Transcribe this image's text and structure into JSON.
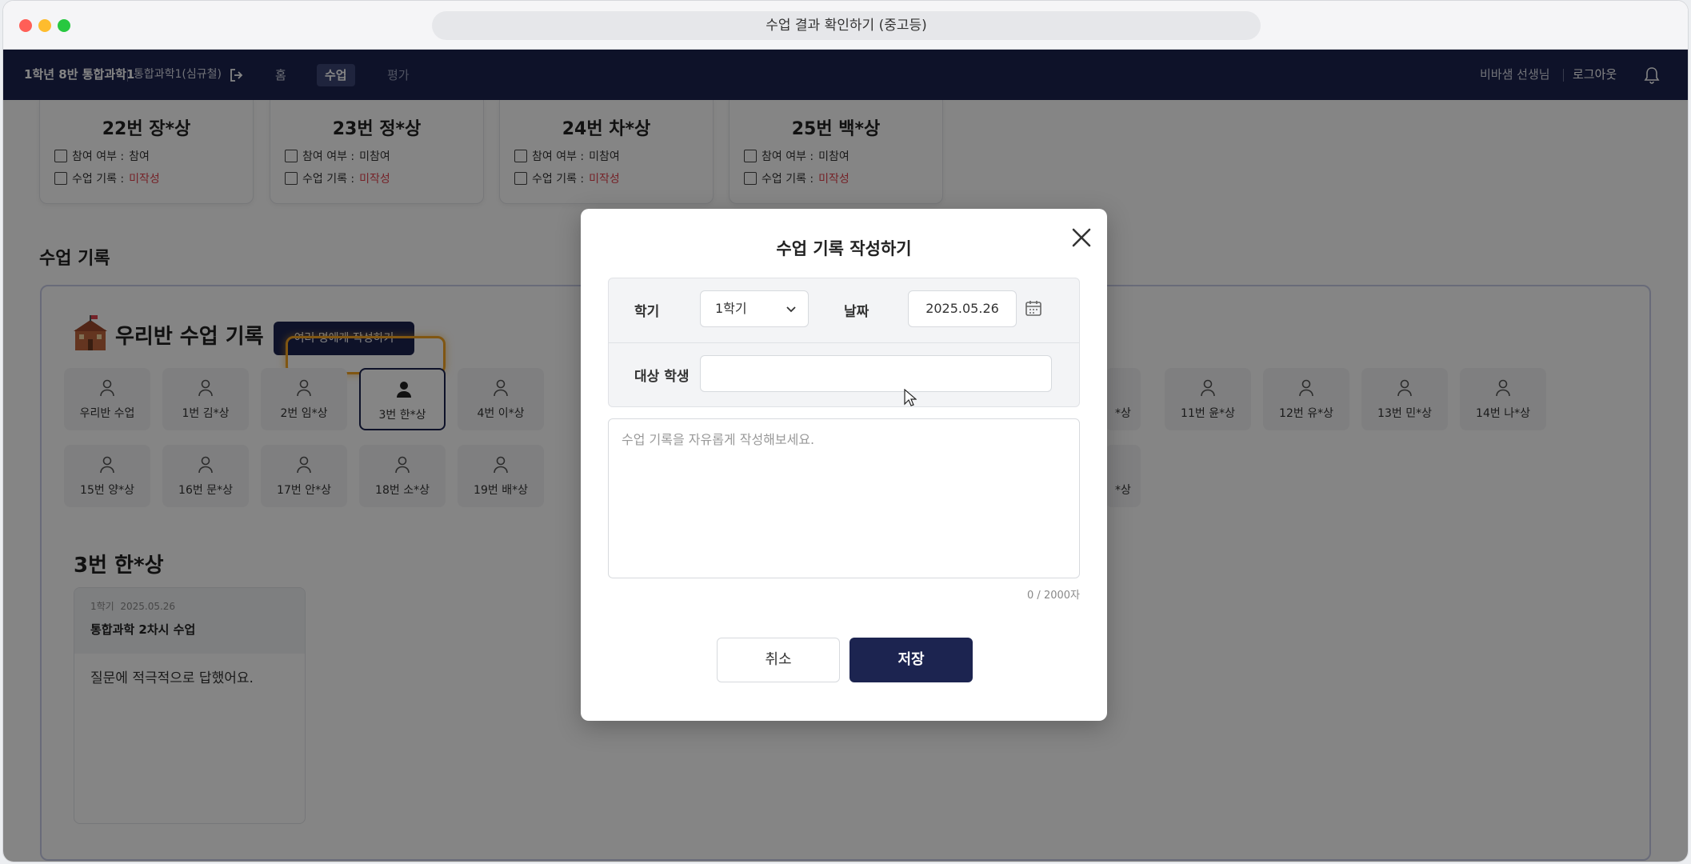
{
  "browser": {
    "tab_title": "수업 결과 확인하기 (중고등)"
  },
  "nav": {
    "class_name": "1학년 8반 통합과학1",
    "subject": "통합과학1(심규철)",
    "home": "홈",
    "class": "수업",
    "evaluation": "평가",
    "teacher": "비바샘 선생님",
    "logout": "로그아웃"
  },
  "top_cards": [
    {
      "name": "22번 장*상",
      "participation_label": "참여 여부 : ",
      "participation_value": "참여",
      "record_label": "수업 기록 : ",
      "record_value": "미작성"
    },
    {
      "name": "23번 정*상",
      "participation_label": "참여 여부 : ",
      "participation_value": "미참여",
      "record_label": "수업 기록 : ",
      "record_value": "미작성"
    },
    {
      "name": "24번 차*상",
      "participation_label": "참여 여부 : ",
      "participation_value": "미참여",
      "record_label": "수업 기록 : ",
      "record_value": "미작성"
    },
    {
      "name": "25번 백*상",
      "participation_label": "참여 여부 : ",
      "participation_value": "미참여",
      "record_label": "수업 기록 : ",
      "record_value": "미작성"
    }
  ],
  "section_title": "수업 기록",
  "panel": {
    "title": "우리반 수업 기록",
    "multi_button": "여러 명에게 작성하기",
    "students_row1": [
      "우리반 수업",
      "1번 김*상",
      "2번 임*상",
      "3번 한*상",
      "4번 이*상",
      "11번 윤*상",
      "12번 유*상",
      "13번 민*상",
      "14번 나*상"
    ],
    "students_row2": [
      "15번 양*상",
      "16번 문*상",
      "17번 안*상",
      "18번 소*상",
      "19번 배*상"
    ],
    "partial_row1": "*상",
    "partial_row2": "*상",
    "selected_student_title": "3번 한*상",
    "record": {
      "semester": "1학기",
      "date": "2025.05.26",
      "title": "통합과학 2차시 수업",
      "body": "질문에 적극적으로 답했어요."
    }
  },
  "modal": {
    "title": "수업 기록 작성하기",
    "semester_label": "학기",
    "semester_value": "1학기",
    "date_label": "날짜",
    "date_value": "2025.05.26",
    "target_label": "대상 학생",
    "target_value": "",
    "textarea_placeholder": "수업 기록을 자유롭게 작성해보세요.",
    "counter": "0 / 2000자",
    "cancel": "취소",
    "save": "저장"
  },
  "colors": {
    "navy": "#1c2450",
    "warn": "#e0424d",
    "highlight": "#f5a623"
  }
}
